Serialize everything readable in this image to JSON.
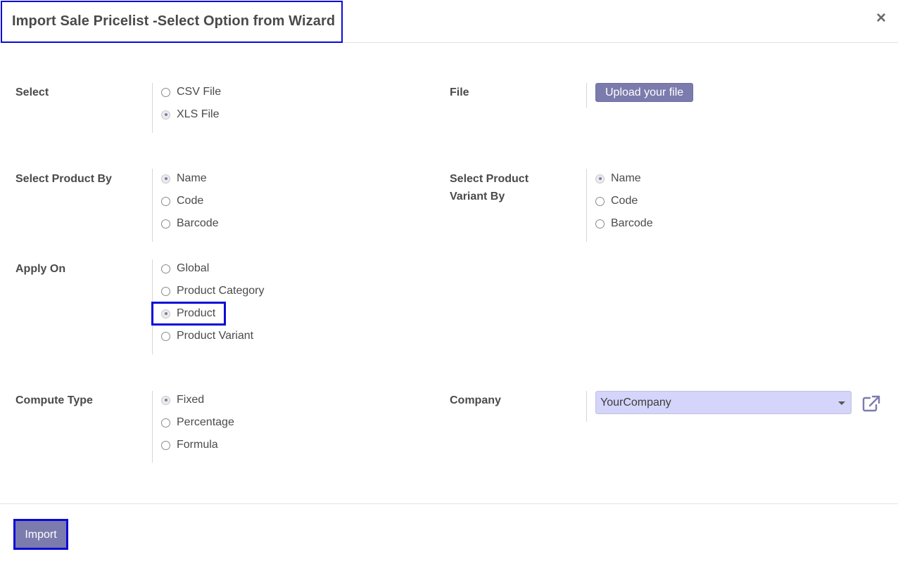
{
  "dialog": {
    "title": "Import Sale Pricelist -Select Option from Wizard",
    "close_glyph": "×"
  },
  "form": {
    "select": {
      "label": "Select",
      "options": [
        {
          "label": "CSV File",
          "checked": false
        },
        {
          "label": "XLS File",
          "checked": true
        }
      ]
    },
    "file": {
      "label": "File",
      "button_label": "Upload your file"
    },
    "product_by": {
      "label": "Select Product By",
      "options": [
        {
          "label": "Name",
          "checked": true
        },
        {
          "label": "Code",
          "checked": false
        },
        {
          "label": "Barcode",
          "checked": false
        }
      ]
    },
    "variant_by": {
      "label_line1": "Select Product",
      "label_line2": "Variant By",
      "options": [
        {
          "label": "Name",
          "checked": true
        },
        {
          "label": "Code",
          "checked": false
        },
        {
          "label": "Barcode",
          "checked": false
        }
      ]
    },
    "apply_on": {
      "label": "Apply On",
      "options": [
        {
          "label": "Global",
          "checked": false
        },
        {
          "label": "Product Category",
          "checked": false
        },
        {
          "label": "Product",
          "checked": true
        },
        {
          "label": "Product Variant",
          "checked": false
        }
      ]
    },
    "compute_type": {
      "label": "Compute Type",
      "options": [
        {
          "label": "Fixed",
          "checked": true
        },
        {
          "label": "Percentage",
          "checked": false
        },
        {
          "label": "Formula",
          "checked": false
        }
      ]
    },
    "company": {
      "label": "Company",
      "value": "YourCompany",
      "external_link_icon": "external-link-icon"
    }
  },
  "footer": {
    "import_label": "Import"
  },
  "colors": {
    "primary": "#7c7bad",
    "highlight": "#0a0ad8",
    "select_bg": "#d5d5fb"
  }
}
